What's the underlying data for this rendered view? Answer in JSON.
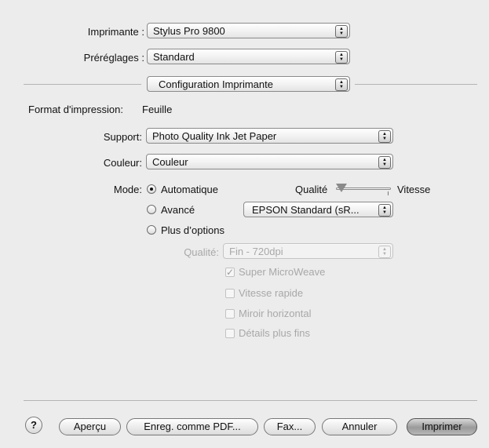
{
  "printer": {
    "label": "Imprimante :",
    "value": "Stylus Pro 9800"
  },
  "presets": {
    "label": "Préréglages :",
    "value": "Standard"
  },
  "panel_menu": {
    "value": "Configuration Imprimante"
  },
  "print_format": {
    "label": "Format d'impression:",
    "value": "Feuille"
  },
  "media": {
    "label": "Support:",
    "value": "Photo Quality Ink Jet Paper"
  },
  "color": {
    "label": "Couleur:",
    "value": "Couleur"
  },
  "mode": {
    "label": "Mode:",
    "automatic_label": "Automatique",
    "advanced_label": "Avancé",
    "more_options_label": "Plus d’options",
    "selected": "Automatique",
    "slider_left_label": "Qualité",
    "slider_right_label": "Vitesse",
    "slider_level": 0,
    "color_mode_value": "EPSON Standard (sR..."
  },
  "quality": {
    "label": "Qualité:",
    "value": "Fin - 720dpi"
  },
  "options": [
    {
      "label": "Super MicroWeave",
      "checked": true
    },
    {
      "label": "Vitesse rapide",
      "checked": false
    },
    {
      "label": "Miroir horizontal",
      "checked": false
    },
    {
      "label": "Détails plus fins",
      "checked": false
    }
  ],
  "buttons": {
    "help": "?",
    "preview": "Aperçu",
    "save_pdf": "Enreg. comme PDF...",
    "fax": "Fax...",
    "cancel": "Annuler",
    "print": "Imprimer"
  }
}
